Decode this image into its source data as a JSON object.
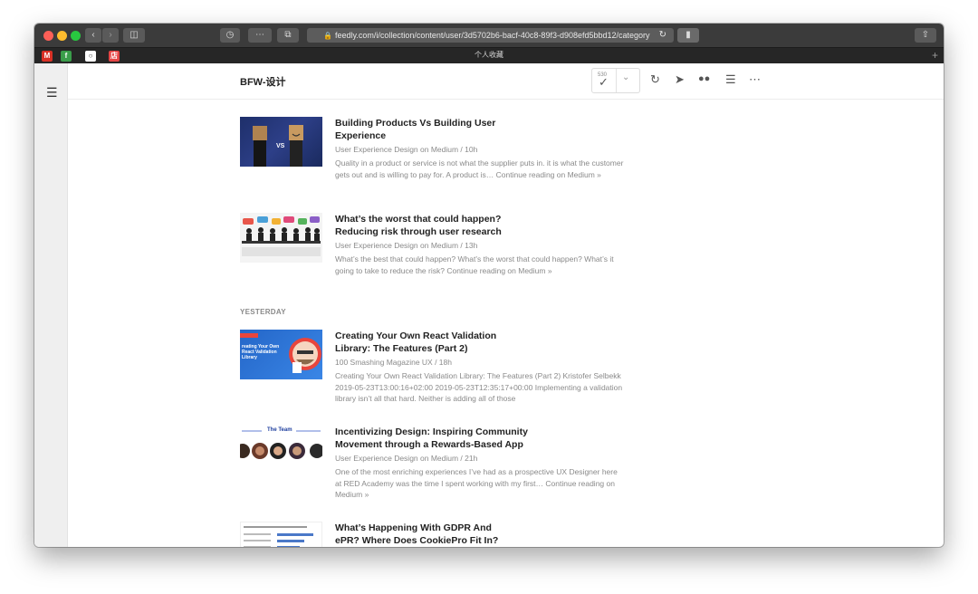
{
  "browser": {
    "url": "feedly.com/i/collection/content/user/3d5702b6-bacf-40c8-89f3-d908efd5bbd12/category",
    "tab_title": "个人收藏",
    "new_tab_label": "+"
  },
  "header": {
    "title": "BFW-设计",
    "unread_count": "530"
  },
  "sections": {
    "yesterday_label": "YESTERDAY"
  },
  "articles": [
    {
      "title": "Building Products Vs Building User Experience",
      "meta": "User Experience Design on Medium / 10h",
      "desc": "Quality in a product or service is not what the supplier puts in. it is what the customer gets out and is willing to pay for. A product is… Continue reading on Medium »",
      "thumb_text": "VS"
    },
    {
      "title": "What’s the worst that could happen? Reducing risk through user research",
      "meta": "User Experience Design on Medium / 13h",
      "desc": "What’s the best that could happen? What’s the worst that could happen? What’s it going to take to reduce the risk? Continue reading on Medium »"
    },
    {
      "title": "Creating Your Own React Validation Library: The Features (Part 2)",
      "meta": "100  Smashing Magazine UX / 18h",
      "desc": "Creating Your Own React Validation Library: The Features (Part 2) Kristofer Selbekk 2019-05-23T13:00:16+02:00 2019-05-23T12:35:17+00:00 Implementing a validation library isn’t all that hard. Neither is adding all of those",
      "thumb_text": "reating Your Own React Validation Library"
    },
    {
      "title": "Incentivizing Design: Inspiring Community Movement through a Rewards-Based App",
      "meta": "User Experience Design on Medium / 21h",
      "desc": "One of the most enriching experiences I’ve had as a prospective UX Designer here at RED Academy was the time I spent working with my first… Continue reading on Medium »",
      "thumb_text": "The Team"
    },
    {
      "title": "What’s Happening With GDPR And ePR? Where Does CookiePro Fit In?",
      "meta": "",
      "desc": ""
    }
  ],
  "colors": {
    "titlebar": "#3b3b3b",
    "tabbar": "#262626",
    "sidebar": "#efefef",
    "title_text": "#222222",
    "meta_text": "#8a8a8a"
  }
}
